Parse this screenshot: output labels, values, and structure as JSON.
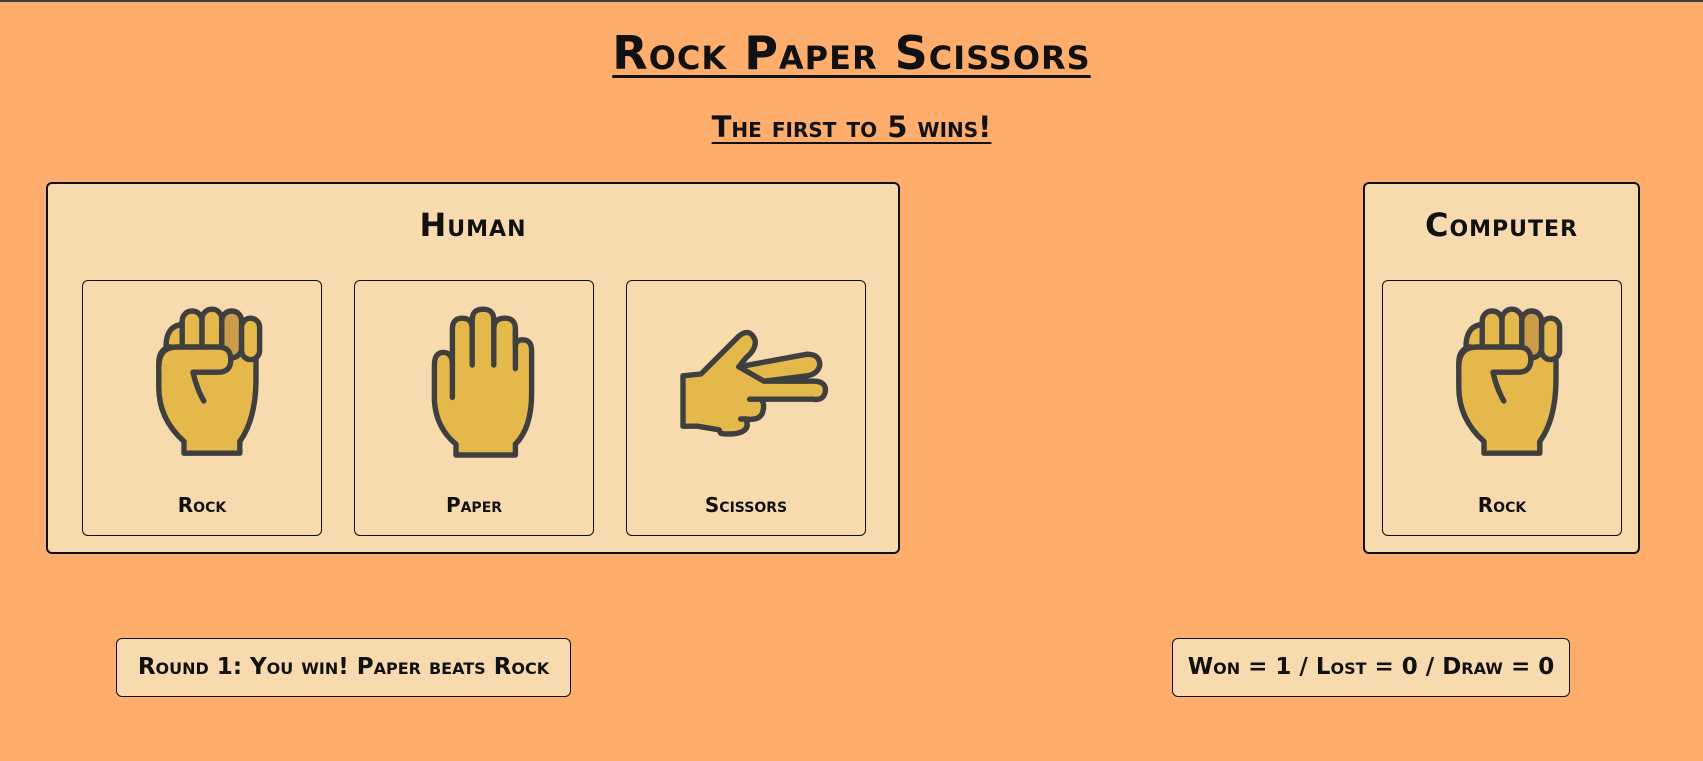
{
  "header": {
    "title": "Rock Paper Scissors",
    "subtitle": "The first to 5 wins!"
  },
  "human": {
    "title": "Human",
    "choices": [
      {
        "label": "Rock",
        "icon": "fist-icon"
      },
      {
        "label": "Paper",
        "icon": "open-hand-icon"
      },
      {
        "label": "Scissors",
        "icon": "two-fingers-icon"
      }
    ]
  },
  "computer": {
    "title": "Computer",
    "choice": {
      "label": "Rock",
      "icon": "fist-icon"
    }
  },
  "status": {
    "round_message": "Round 1: You win! Paper beats Rock",
    "score": "Won = 1 / Lost = 0 / Draw = 0"
  },
  "colors": {
    "background": "#ffad6c",
    "panel": "#f7dbae",
    "hand_fill": "#e5b84c",
    "hand_shadow": "#cc9c4a",
    "hand_outline": "#3f3f3f"
  }
}
